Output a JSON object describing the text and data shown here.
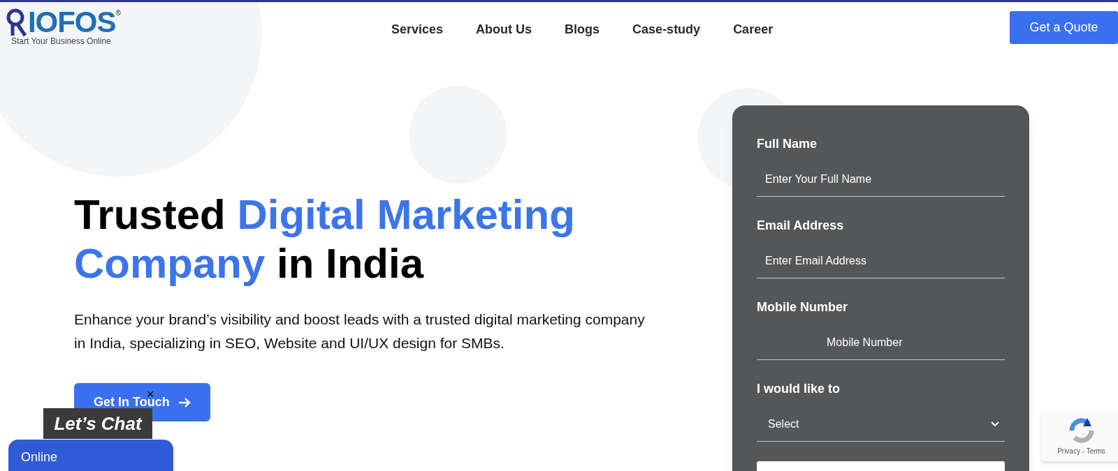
{
  "header": {
    "logo": {
      "wordmark": "IOFOS",
      "registered": "®",
      "tagline": "Start Your Business Online"
    },
    "nav": [
      {
        "label": "Services"
      },
      {
        "label": "About Us"
      },
      {
        "label": "Blogs"
      },
      {
        "label": "Case-study"
      },
      {
        "label": "Career"
      }
    ],
    "cta": "Get a Quote"
  },
  "hero": {
    "heading_lines": [
      [
        {
          "text": "Trusted ",
          "highlight": false
        },
        {
          "text": "Digital Marketing",
          "highlight": true
        }
      ],
      [
        {
          "text": "Company",
          "highlight": true
        },
        {
          "text": " in India",
          "highlight": false
        }
      ]
    ],
    "description": "Enhance your brand’s visibility and boost leads with a trusted digital marketing company in India, specializing in SEO, Website and UI/UX design for SMBs.",
    "button": "Get In Touch"
  },
  "form": {
    "fields": [
      {
        "kind": "text",
        "label": "Full Name",
        "placeholder": "Enter Your Full Name"
      },
      {
        "kind": "text",
        "label": "Email Address",
        "placeholder": "Enter Email Address"
      },
      {
        "kind": "phone",
        "label": "Mobile Number",
        "placeholder": "Mobile Number"
      },
      {
        "kind": "select",
        "label": "I would like to",
        "value": "Select"
      }
    ]
  },
  "chat": {
    "close": "×",
    "badge": "Let’s Chat",
    "status": "Online"
  },
  "recaptcha": {
    "links": "Privacy - Terms"
  }
}
